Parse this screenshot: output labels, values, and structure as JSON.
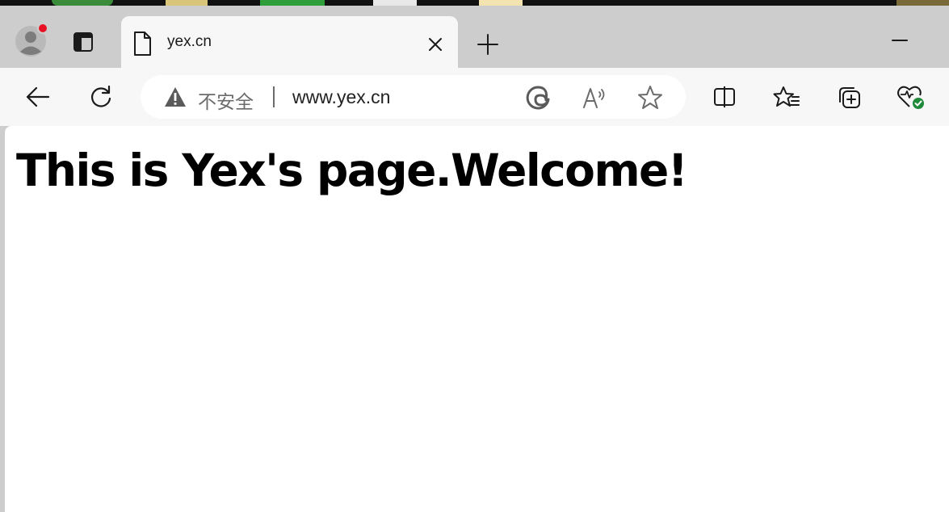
{
  "window": {
    "tab": {
      "title": "yex.cn",
      "icon": "page-icon"
    },
    "controls": {
      "minimize_icon": "minimize-icon",
      "new_tab_icon": "plus-icon"
    }
  },
  "toolbar": {
    "back_icon": "arrow-left-icon",
    "refresh_icon": "refresh-icon",
    "addressbar": {
      "security_label": "不安全",
      "url": "www.yex.cn",
      "security_icon": "warning-triangle-icon"
    },
    "right_icons": [
      "split-screen-icon",
      "favorites-icon",
      "collections-icon",
      "browser-essentials-icon"
    ]
  },
  "page": {
    "heading": "This is Yex's page.Welcome!"
  },
  "colors": {
    "tabbar_bg": "#cdcdcd",
    "toolbar_bg": "#f7f7f7",
    "content_bg": "#ffffff",
    "profile_notification": "#e81123",
    "health_ok": "#1e8a3a"
  }
}
